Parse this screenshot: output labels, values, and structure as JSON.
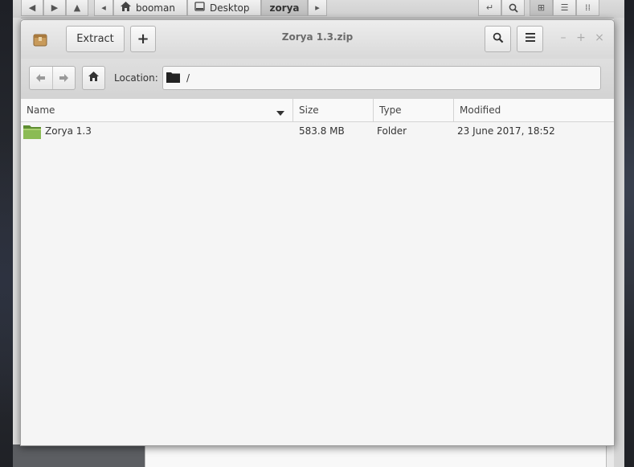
{
  "background_window": {
    "breadcrumbs": [
      {
        "label": "booman",
        "icon": "home-icon"
      },
      {
        "label": "Desktop",
        "icon": "drive-icon"
      },
      {
        "label": "zorya",
        "icon": ""
      }
    ]
  },
  "window": {
    "title": "Zorya 1.3.zip",
    "toolbar": {
      "extract_label": "Extract",
      "add_label": "+"
    },
    "location": {
      "label": "Location:",
      "value": "/"
    },
    "columns": [
      "Name",
      "Size",
      "Type",
      "Modified"
    ],
    "rows": [
      {
        "name": "Zorya 1.3",
        "size": "583.8 MB",
        "type": "Folder",
        "modified": "23 June 2017, 18:52",
        "icon": "folder-icon"
      }
    ]
  },
  "colors": {
    "folder_green": "#7fb04b",
    "header_bg": "#e3e3e3",
    "list_bg": "#f5f5f5"
  }
}
